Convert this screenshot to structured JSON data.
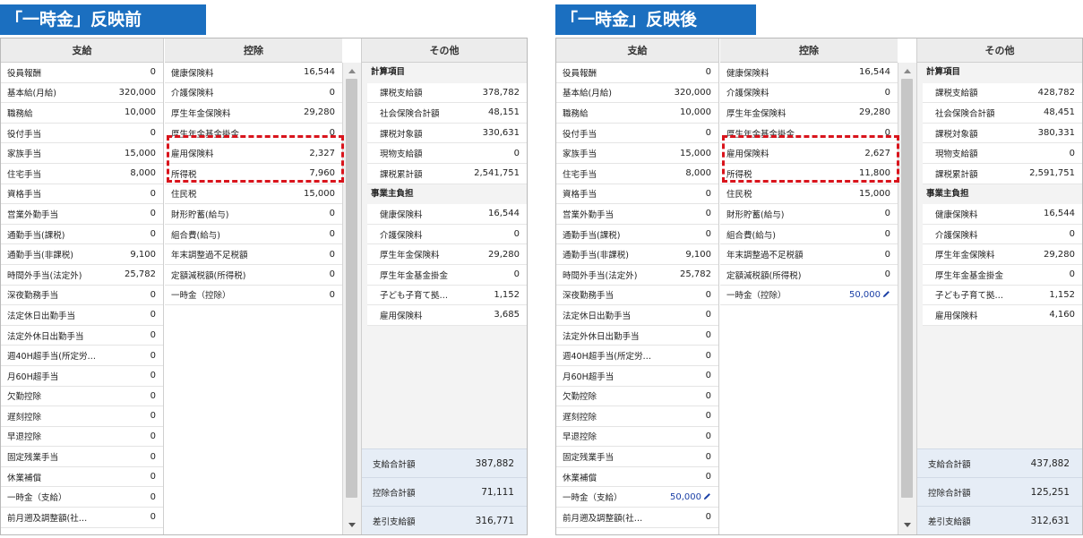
{
  "before": {
    "title": "「一時金」反映前",
    "headers": {
      "shikyu": "支給",
      "kojo": "控除",
      "other": "その他"
    },
    "shikyu_rows": [
      {
        "label": "役員報酬",
        "value": "0"
      },
      {
        "label": "基本給(月給)",
        "value": "320,000"
      },
      {
        "label": "職務給",
        "value": "10,000"
      },
      {
        "label": "役付手当",
        "value": "0"
      },
      {
        "label": "家族手当",
        "value": "15,000"
      },
      {
        "label": "住宅手当",
        "value": "8,000"
      },
      {
        "label": "資格手当",
        "value": "0"
      },
      {
        "label": "営業外勤手当",
        "value": "0"
      },
      {
        "label": "通勤手当(課税)",
        "value": "0"
      },
      {
        "label": "通勤手当(非課税)",
        "value": "9,100"
      },
      {
        "label": "時間外手当(法定外)",
        "value": "25,782"
      },
      {
        "label": "深夜勤務手当",
        "value": "0"
      },
      {
        "label": "法定休日出勤手当",
        "value": "0"
      },
      {
        "label": "法定外休日出勤手当",
        "value": "0"
      },
      {
        "label": "週40H超手当(所定労…",
        "value": "0"
      },
      {
        "label": "月60H超手当",
        "value": "0"
      },
      {
        "label": "欠勤控除",
        "value": "0"
      },
      {
        "label": "遅刻控除",
        "value": "0"
      },
      {
        "label": "早退控除",
        "value": "0"
      },
      {
        "label": "固定残業手当",
        "value": "0"
      },
      {
        "label": "休業補償",
        "value": "0"
      },
      {
        "label": "一時金（支給）",
        "value": "0"
      },
      {
        "label": "前月遡及調整額(社…",
        "value": "0"
      }
    ],
    "kojo_rows": [
      {
        "label": "健康保険料",
        "value": "16,544"
      },
      {
        "label": "介護保険料",
        "value": "0"
      },
      {
        "label": "厚生年金保険料",
        "value": "29,280"
      },
      {
        "label": "厚生年金基金掛金",
        "value": "0"
      },
      {
        "label": "雇用保険料",
        "value": "2,327"
      },
      {
        "label": "所得税",
        "value": "7,960"
      },
      {
        "label": "住民税",
        "value": "15,000"
      },
      {
        "label": "財形貯蓄(給与)",
        "value": "0"
      },
      {
        "label": "組合費(給与)",
        "value": "0"
      },
      {
        "label": "年末調整過不足税額",
        "value": "0"
      },
      {
        "label": "定額減税額(所得税)",
        "value": "0"
      },
      {
        "label": "一時金（控除）",
        "value": "0"
      }
    ],
    "other": {
      "section1": "計算項目",
      "calc_rows": [
        {
          "label": "課税支給額",
          "value": "378,782"
        },
        {
          "label": "社会保険合計額",
          "value": "48,151"
        },
        {
          "label": "課税対象額",
          "value": "330,631"
        },
        {
          "label": "現物支給額",
          "value": "0"
        },
        {
          "label": "課税累計額",
          "value": "2,541,751"
        }
      ],
      "section2": "事業主負担",
      "employer_rows": [
        {
          "label": "健康保険料",
          "value": "16,544"
        },
        {
          "label": "介護保険料",
          "value": "0"
        },
        {
          "label": "厚生年金保険料",
          "value": "29,280"
        },
        {
          "label": "厚生年金基金掛金",
          "value": "0"
        },
        {
          "label": "子ども子育て拠…",
          "value": "1,152"
        },
        {
          "label": "雇用保険料",
          "value": "3,685"
        }
      ],
      "totals": [
        {
          "label": "支給合計額",
          "value": "387,882"
        },
        {
          "label": "控除合計額",
          "value": "71,111"
        },
        {
          "label": "差引支給額",
          "value": "316,771"
        }
      ]
    }
  },
  "after": {
    "title": "「一時金」反映後",
    "headers": {
      "shikyu": "支給",
      "kojo": "控除",
      "other": "その他"
    },
    "shikyu_rows": [
      {
        "label": "役員報酬",
        "value": "0"
      },
      {
        "label": "基本給(月給)",
        "value": "320,000"
      },
      {
        "label": "職務給",
        "value": "10,000"
      },
      {
        "label": "役付手当",
        "value": "0"
      },
      {
        "label": "家族手当",
        "value": "15,000"
      },
      {
        "label": "住宅手当",
        "value": "8,000"
      },
      {
        "label": "資格手当",
        "value": "0"
      },
      {
        "label": "営業外勤手当",
        "value": "0"
      },
      {
        "label": "通勤手当(課税)",
        "value": "0"
      },
      {
        "label": "通勤手当(非課税)",
        "value": "9,100"
      },
      {
        "label": "時間外手当(法定外)",
        "value": "25,782"
      },
      {
        "label": "深夜勤務手当",
        "value": "0"
      },
      {
        "label": "法定休日出勤手当",
        "value": "0"
      },
      {
        "label": "法定外休日出勤手当",
        "value": "0"
      },
      {
        "label": "週40H超手当(所定労…",
        "value": "0"
      },
      {
        "label": "月60H超手当",
        "value": "0"
      },
      {
        "label": "欠勤控除",
        "value": "0"
      },
      {
        "label": "遅刻控除",
        "value": "0"
      },
      {
        "label": "早退控除",
        "value": "0"
      },
      {
        "label": "固定残業手当",
        "value": "0"
      },
      {
        "label": "休業補償",
        "value": "0"
      },
      {
        "label": "一時金（支給）",
        "value": "50,000"
      },
      {
        "label": "前月遡及調整額(社…",
        "value": "0"
      }
    ],
    "kojo_rows": [
      {
        "label": "健康保険料",
        "value": "16,544"
      },
      {
        "label": "介護保険料",
        "value": "0"
      },
      {
        "label": "厚生年金保険料",
        "value": "29,280"
      },
      {
        "label": "厚生年金基金掛金",
        "value": "0"
      },
      {
        "label": "雇用保険料",
        "value": "2,627"
      },
      {
        "label": "所得税",
        "value": "11,800"
      },
      {
        "label": "住民税",
        "value": "15,000"
      },
      {
        "label": "財形貯蓄(給与)",
        "value": "0"
      },
      {
        "label": "組合費(給与)",
        "value": "0"
      },
      {
        "label": "年末調整過不足税額",
        "value": "0"
      },
      {
        "label": "定額減税額(所得税)",
        "value": "0"
      },
      {
        "label": "一時金（控除）",
        "value": "50,000"
      }
    ],
    "other": {
      "section1": "計算項目",
      "calc_rows": [
        {
          "label": "課税支給額",
          "value": "428,782"
        },
        {
          "label": "社会保険合計額",
          "value": "48,451"
        },
        {
          "label": "課税対象額",
          "value": "380,331"
        },
        {
          "label": "現物支給額",
          "value": "0"
        },
        {
          "label": "課税累計額",
          "value": "2,591,751"
        }
      ],
      "section2": "事業主負担",
      "employer_rows": [
        {
          "label": "健康保険料",
          "value": "16,544"
        },
        {
          "label": "介護保険料",
          "value": "0"
        },
        {
          "label": "厚生年金保険料",
          "value": "29,280"
        },
        {
          "label": "厚生年金基金掛金",
          "value": "0"
        },
        {
          "label": "子ども子育て拠…",
          "value": "1,152"
        },
        {
          "label": "雇用保険料",
          "value": "4,160"
        }
      ],
      "totals": [
        {
          "label": "支給合計額",
          "value": "437,882"
        },
        {
          "label": "控除合計額",
          "value": "125,251"
        },
        {
          "label": "差引支給額",
          "value": "312,631"
        }
      ]
    }
  },
  "colors": {
    "title_bg": "#1b6fc0",
    "highlight": "#d9141c",
    "edited_value": "#1a3fa6"
  },
  "icons": {
    "edit": "pencil-icon"
  }
}
